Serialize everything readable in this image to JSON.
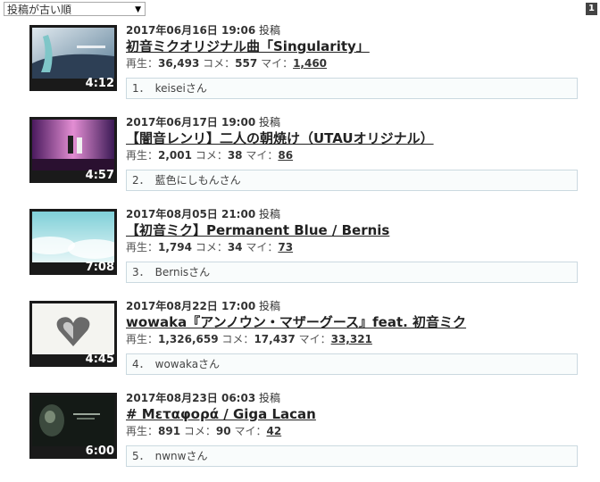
{
  "sort": {
    "selected": "投稿が古い順"
  },
  "page": {
    "badge": "1"
  },
  "labels": {
    "posted_suffix": "投稿",
    "views": "再生：",
    "comments": "コメ：",
    "mylists": "マイ："
  },
  "videos": [
    {
      "posted": "2017年06月16日 19:06",
      "title": "初音ミクオリジナル曲「Singularity」",
      "views": "36,493",
      "comments": "557",
      "mylists": "1,460",
      "duration": "4:12",
      "rank": "1．",
      "user": "keiseiさん"
    },
    {
      "posted": "2017年06月17日 19:00",
      "title": "【闇音レンリ】二人の朝焼け（UTAUオリジナル）",
      "views": "2,001",
      "comments": "38",
      "mylists": "86",
      "duration": "4:57",
      "rank": "2．",
      "user": "藍色にしもんさん"
    },
    {
      "posted": "2017年08月05日 21:00",
      "title": "【初音ミク】Permanent Blue / Bernis",
      "views": "1,794",
      "comments": "34",
      "mylists": "73",
      "duration": "7:08",
      "rank": "3．",
      "user": "Bernisさん"
    },
    {
      "posted": "2017年08月22日 17:00",
      "title": "wowaka『アンノウン・マザーグース』feat. 初音ミク",
      "views": "1,326,659",
      "comments": "17,437",
      "mylists": "33,321",
      "duration": "4:45",
      "rank": "4．",
      "user": "wowakaさん"
    },
    {
      "posted": "2017年08月23日 06:03",
      "title": "# Μεταφορά / Giga Lacan",
      "views": "891",
      "comments": "90",
      "mylists": "42",
      "duration": "6:00",
      "rank": "5．",
      "user": "nwnwさん"
    }
  ]
}
